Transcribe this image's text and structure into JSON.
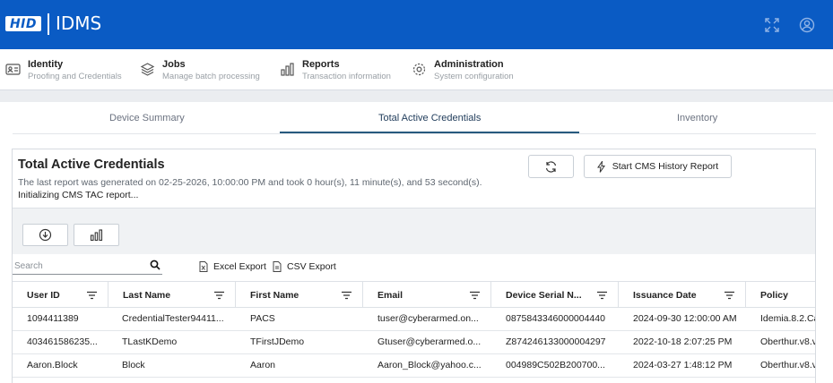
{
  "header": {
    "logo_text": "HID",
    "app_name": "IDMS"
  },
  "menu": [
    {
      "title": "Identity",
      "subtitle": "Proofing and Credentials"
    },
    {
      "title": "Jobs",
      "subtitle": "Manage batch processing"
    },
    {
      "title": "Reports",
      "subtitle": "Transaction information"
    },
    {
      "title": "Administration",
      "subtitle": "System configuration"
    }
  ],
  "tabs": [
    "Device Summary",
    "Total Active Credentials",
    "Inventory"
  ],
  "report": {
    "title": "Total Active Credentials",
    "meta": "The last report was generated on 02-25-2026, 10:00:00 PM and took 0 hour(s), 11 minute(s), and 53 second(s).",
    "status": "Initializing CMS TAC report...",
    "start_button": "Start CMS History Report"
  },
  "search": {
    "placeholder": "Search"
  },
  "exports": {
    "excel": "Excel Export",
    "csv": "CSV Export"
  },
  "table": {
    "columns": [
      "User ID",
      "Last Name",
      "First Name",
      "Email",
      "Device Serial N...",
      "Issuance Date",
      "Policy"
    ],
    "rows": [
      [
        "1094411389",
        "CredentialTester94411...",
        "PACS",
        "tuser@cyberarmed.on...",
        "0875843346000004440",
        "2024-09-30 12:00:00 AM",
        "Idemia.8.2.Ca"
      ],
      [
        "403461586235...",
        "TLastKDemo",
        "TFirstJDemo",
        "Gtuser@cyberarmed.o...",
        "Z874246133000004297",
        "2022-10-18 2:07:25 PM",
        "Oberthur.v8.v"
      ],
      [
        "Aaron.Block",
        "Block",
        "Aaron",
        "Aaron_Block@yahoo.c...",
        "004989C502B200700...",
        "2024-03-27 1:48:12 PM",
        "Oberthur.v8.v"
      ]
    ]
  }
}
